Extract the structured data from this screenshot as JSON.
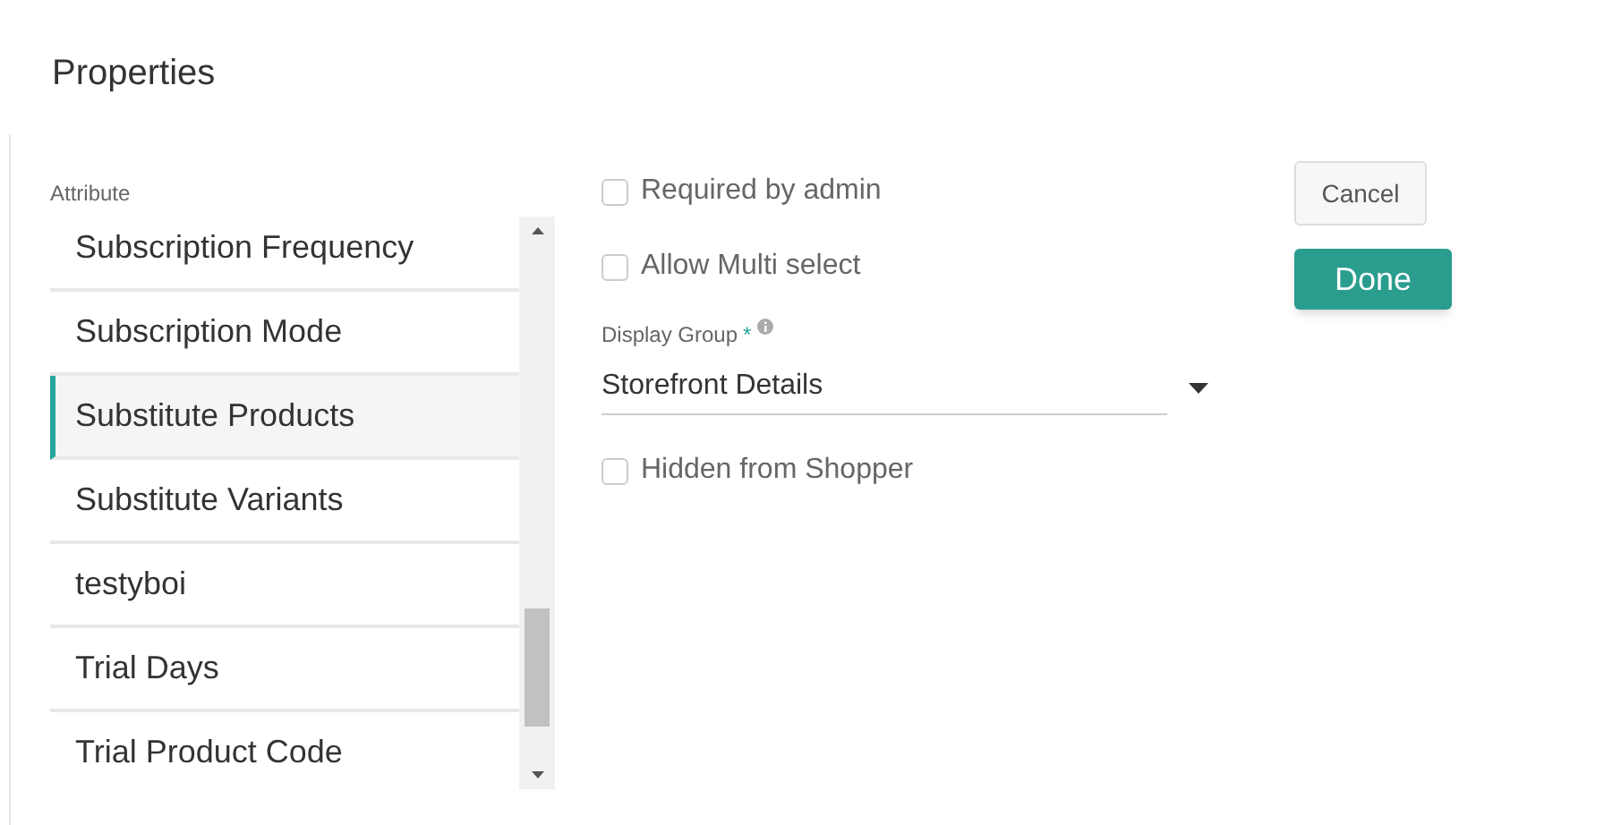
{
  "title": "Properties",
  "attribute_list": {
    "label": "Attribute",
    "items": [
      {
        "label": "Subscription Frequency",
        "selected": false
      },
      {
        "label": "Subscription Mode",
        "selected": false
      },
      {
        "label": "Substitute Products",
        "selected": true
      },
      {
        "label": "Substitute Variants",
        "selected": false
      },
      {
        "label": "testyboi",
        "selected": false
      },
      {
        "label": "Trial Days",
        "selected": false
      },
      {
        "label": "Trial Product Code",
        "selected": false
      }
    ]
  },
  "options": [
    {
      "kind": "checkbox",
      "label": "Required by admin",
      "checked": false
    },
    {
      "kind": "checkbox",
      "label": "Allow Multi select",
      "checked": false
    },
    {
      "kind": "select",
      "label": "Display Group",
      "required_mark": "*",
      "value": "Storefront Details"
    },
    {
      "kind": "checkbox",
      "label": "Hidden from Shopper",
      "checked": false
    }
  ],
  "buttons": [
    {
      "kind": "secondary",
      "label": "Cancel"
    },
    {
      "kind": "primary",
      "label": "Done"
    }
  ]
}
